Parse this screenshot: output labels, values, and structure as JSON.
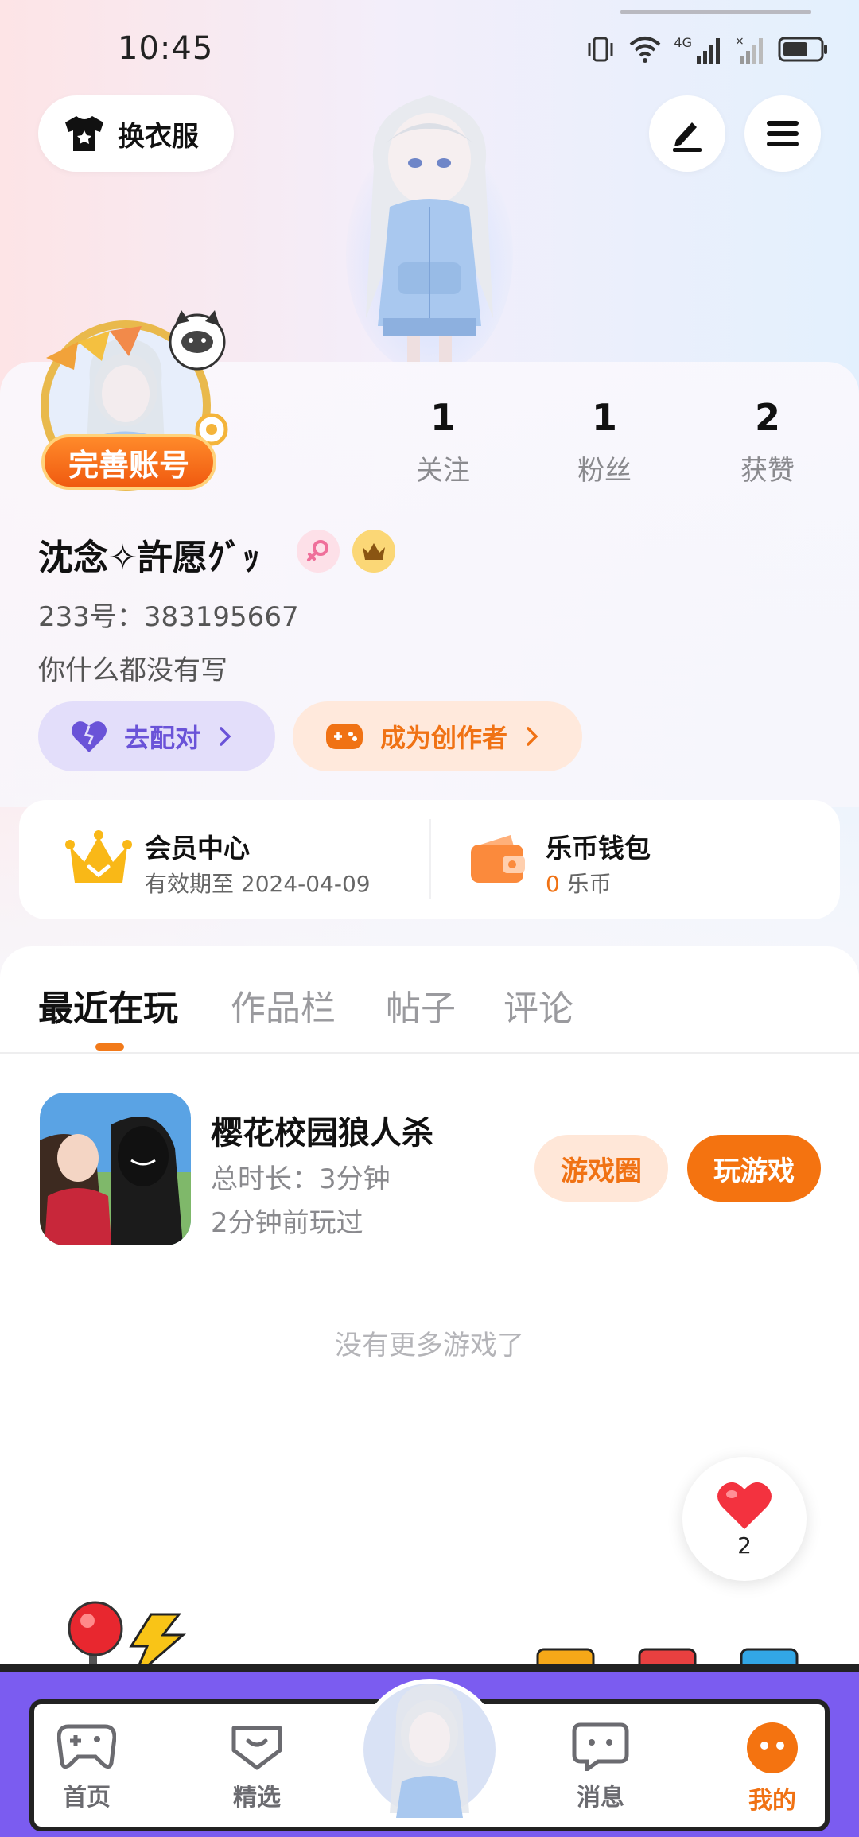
{
  "status_bar": {
    "time": "10:45",
    "network": "4G"
  },
  "header": {
    "outfit_label": "换衣服"
  },
  "profile": {
    "complete_account_label": "完善账号",
    "stats": [
      {
        "value": "1",
        "label": "关注"
      },
      {
        "value": "1",
        "label": "粉丝"
      },
      {
        "value": "2",
        "label": "获赞"
      }
    ],
    "username": "沈念✧許愿ｸﾞｯ",
    "user_id": "233号：383195667",
    "bio": "你什么都没有写",
    "match_label": "去配对",
    "creator_label": "成为创作者"
  },
  "member": {
    "title": "会员中心",
    "validity": "有效期至 2024-04-09",
    "wallet_title": "乐币钱包",
    "wallet_amount": "0",
    "wallet_unit": "乐币"
  },
  "tabs": [
    {
      "label": "最近在玩",
      "active": true
    },
    {
      "label": "作品栏",
      "active": false
    },
    {
      "label": "帖子",
      "active": false
    },
    {
      "label": "评论",
      "active": false
    }
  ],
  "games": [
    {
      "name": "樱花校园狼人杀",
      "duration": "总时长：3分钟",
      "last_played": "2分钟前玩过",
      "circle_label": "游戏圈",
      "play_label": "玩游戏"
    }
  ],
  "no_more_text": "没有更多游戏了",
  "like_float": {
    "count": "2"
  },
  "bottom_nav": [
    {
      "label": "首页",
      "icon": "gamepad-icon",
      "active": false
    },
    {
      "label": "精选",
      "icon": "heart-chat-icon",
      "active": false
    },
    {
      "label": "",
      "icon": "avatar-center",
      "active": false
    },
    {
      "label": "消息",
      "icon": "message-icon",
      "active": false
    },
    {
      "label": "我的",
      "icon": "face-icon",
      "active": true
    }
  ],
  "colors": {
    "accent": "#f47310",
    "purple": "#6a53d8",
    "arcade_purple": "#7b5cf0"
  }
}
